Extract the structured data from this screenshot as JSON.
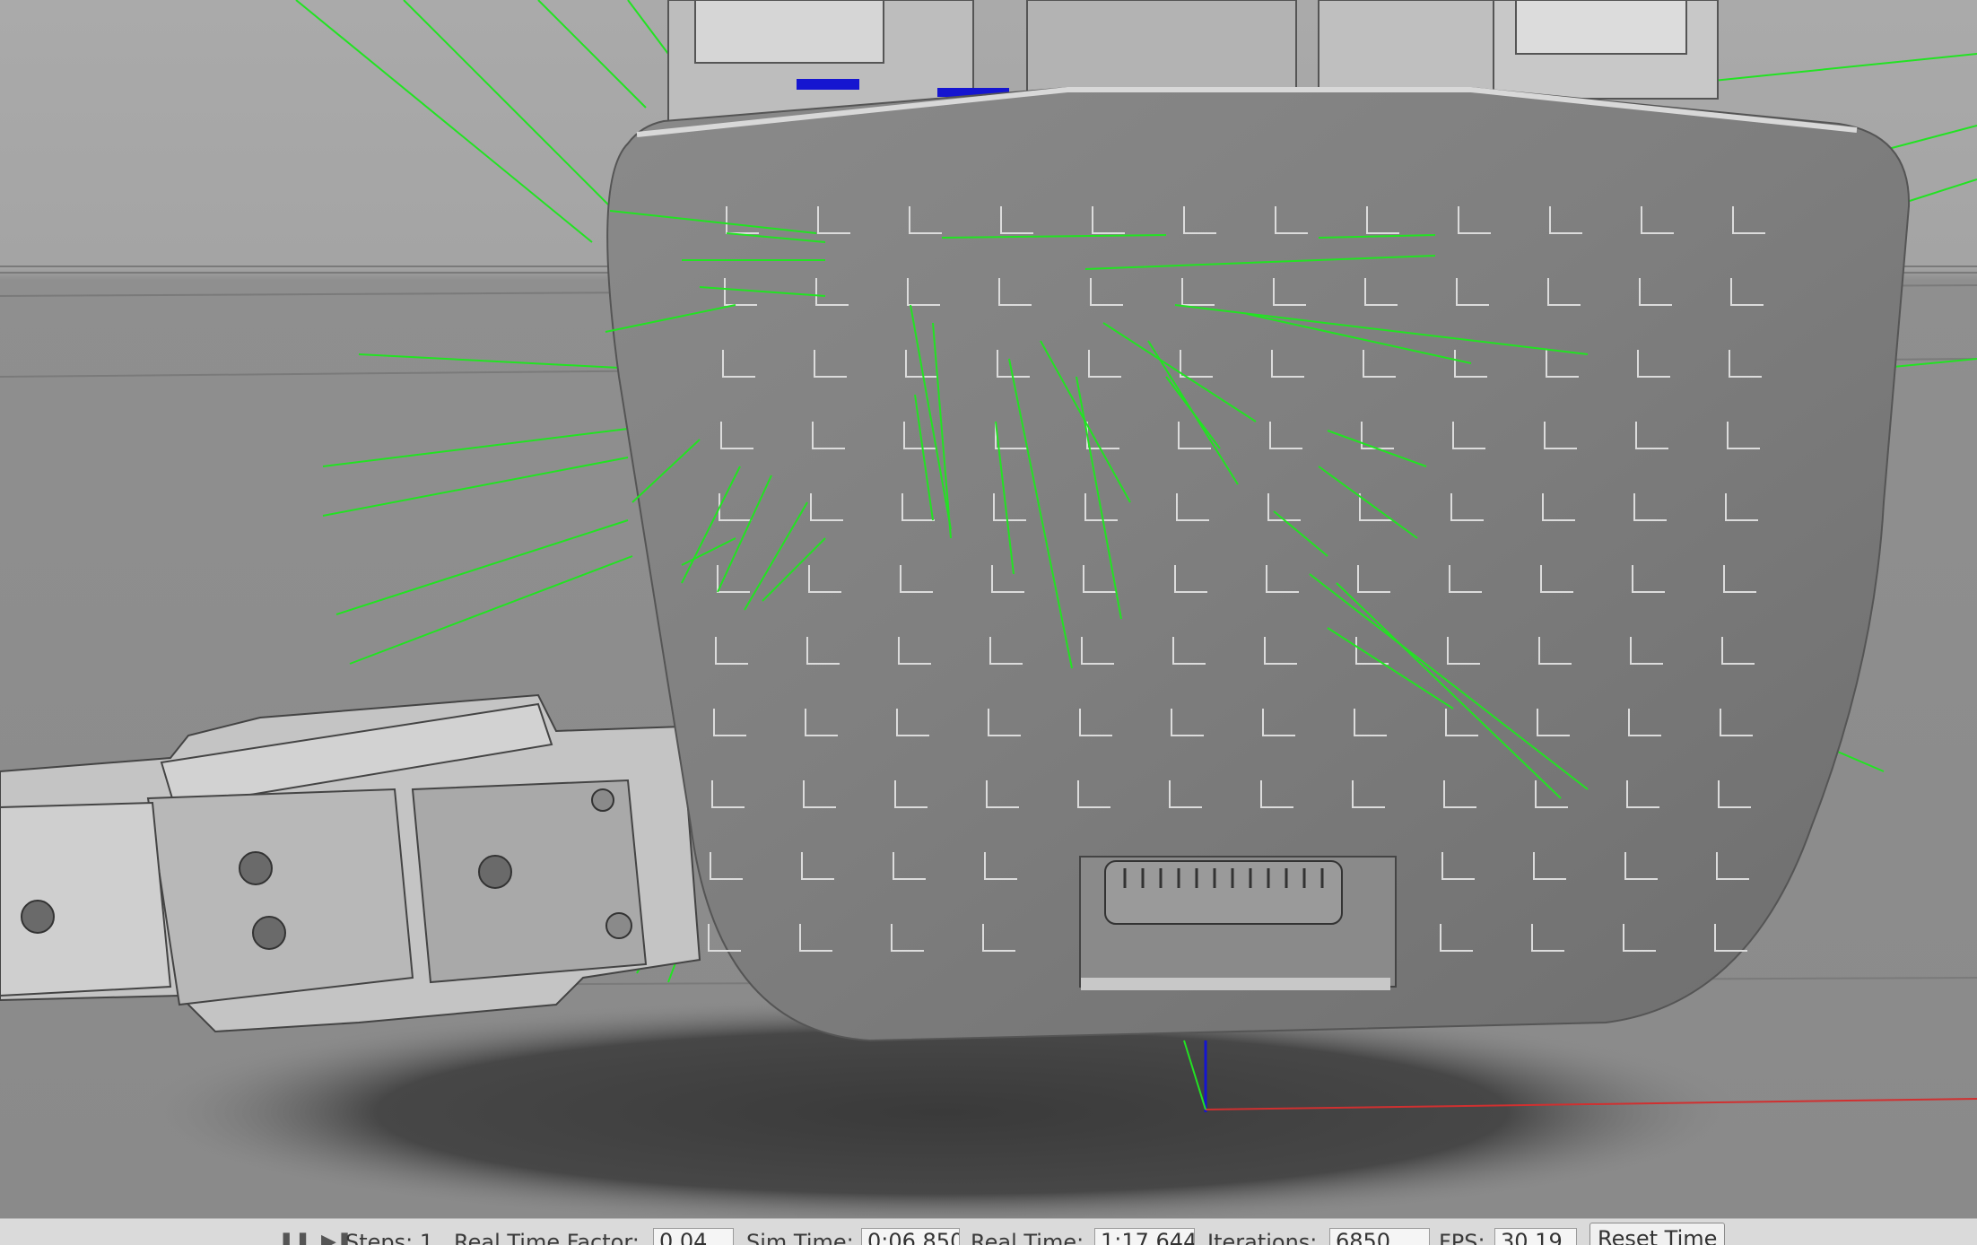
{
  "app": {
    "name": "Gazebo 3D simulation viewport"
  },
  "scene": {
    "background": "#a6a6a6",
    "floor": "#8c8c8c",
    "model_color": "#7e7e7e",
    "contact_line_color": "#22e322",
    "axis_x_color": "#d03030",
    "axis_z_color": "#1515d0"
  },
  "status_bar": {
    "pause_icon": "pause-icon",
    "step_icon": "step-forward-icon",
    "steps_label": "Steps: 1",
    "rtf_label": "Real Time Factor:",
    "rtf_value": "0.04",
    "sim_time_label": "Sim Time:",
    "sim_time_value": "0:06.850",
    "real_time_label": "Real Time:",
    "real_time_value": "1:17.644",
    "iterations_label": "Iterations:",
    "iterations_value": "6850",
    "fps_label": "FPS:",
    "fps_value": "30.19",
    "reset_time_label": "Reset Time"
  }
}
